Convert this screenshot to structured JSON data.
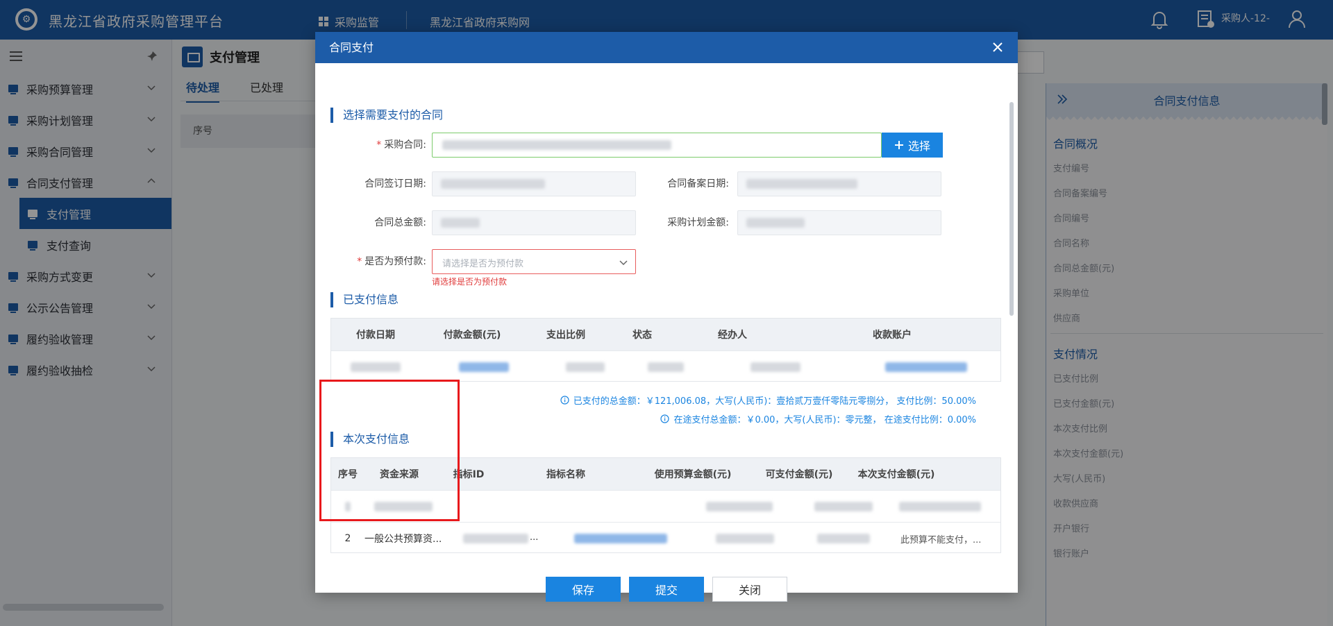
{
  "topbar": {
    "brand": "黑龙江省政府采购管理平台",
    "nav_monitor": "采购监管",
    "nav_site": "黑龙江省政府采购网",
    "user": "采购人-12-"
  },
  "sidebar": {
    "items": [
      {
        "label": "采购预算管理"
      },
      {
        "label": "采购计划管理"
      },
      {
        "label": "采购合同管理"
      },
      {
        "label": "合同支付管理"
      },
      {
        "label": "支付管理"
      },
      {
        "label": "支付查询"
      },
      {
        "label": "采购方式变更"
      },
      {
        "label": "公示公告管理"
      },
      {
        "label": "履约验收管理"
      },
      {
        "label": "履约验收抽检"
      }
    ]
  },
  "main": {
    "title": "支付管理",
    "tab_pending": "待处理",
    "tab_done": "已处理",
    "col_index": "序号"
  },
  "right_panel": {
    "title": "合同支付信息",
    "overview_title": "合同概况",
    "overview_items": [
      "支付编号",
      "合同备案编号",
      "合同编号",
      "合同名称",
      "合同总金额(元)",
      "采购单位",
      "供应商"
    ],
    "payment_title": "支付情况",
    "payment_items": [
      "已支付比例",
      "已支付金额(元)",
      "本次支付比例",
      "本次支付金额(元)",
      "大写(人民币)",
      "收款供应商",
      "开户银行",
      "银行账户"
    ]
  },
  "modal": {
    "title": "合同支付",
    "section_select": "选择需要支付的合同",
    "label_contract": "采购合同:",
    "select_button": "选择",
    "label_sign_date": "合同签订日期:",
    "label_record_date": "合同备案日期:",
    "label_total": "合同总金额:",
    "label_plan_amount": "采购计划金额:",
    "label_prepay": "是否为预付款:",
    "prepay_placeholder": "请选择是否为预付款",
    "prepay_error": "请选择是否为预付款",
    "section_paid": "已支付信息",
    "paid_headers": [
      "付款日期",
      "付款金额(元)",
      "支出比例",
      "状态",
      "经办人",
      "收款账户"
    ],
    "summary_paid": "已支付的总金额：￥121,006.08，大写(人民币)：壹拾贰万壹仟零陆元零捌分， 支付比例：50.00%",
    "summary_transit": "在途支付总金额：￥0.00，大写(人民币)：零元整， 在途支付比例：0.00%",
    "section_current": "本次支付信息",
    "current_headers": [
      "序号",
      "资金来源",
      "指标ID",
      "指标名称",
      "使用预算金额(元)",
      "可支付金额(元)",
      "本次支付金额(元)"
    ],
    "row2_index": "2",
    "row2_source": "一般公共预算资...",
    "row2_id_suffix": "...",
    "row2_note": "此预算不能支付，...",
    "btn_save": "保存",
    "btn_submit": "提交",
    "btn_close": "关闭"
  }
}
